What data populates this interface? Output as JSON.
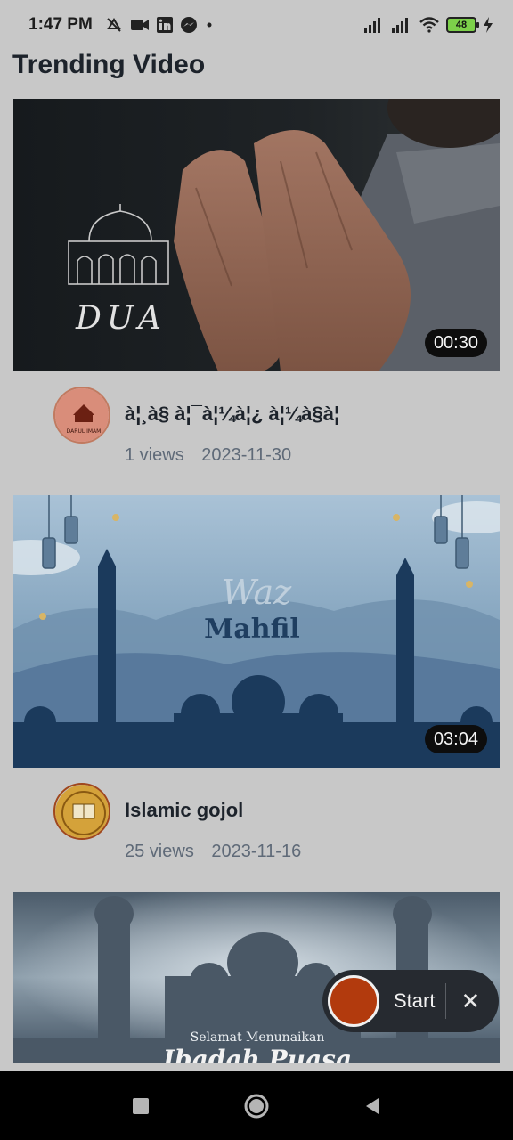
{
  "status_bar": {
    "time": "1:47 PM",
    "battery": "48",
    "icons": [
      "mute-icon",
      "video-camera-icon",
      "linkedin-icon",
      "messenger-icon",
      "dot-icon",
      "signal-icon",
      "signal-icon",
      "wifi-icon",
      "battery-icon",
      "charging-icon"
    ]
  },
  "page": {
    "title": "Trending Video"
  },
  "videos": [
    {
      "thumbnail_text": "DUA",
      "duration": "00:30",
      "title": "à¦¸à§ à¦¯à¦¼à¦¿ à¦¼à§à¦",
      "views": "1 views",
      "date": "2023-11-30",
      "channel_avatar_text": "DARUL IMAM"
    },
    {
      "thumbnail_text_top": "Waz",
      "thumbnail_text_bottom": "Mahfil",
      "duration": "03:04",
      "title": "Islamic gojol",
      "views": "25 views",
      "date": "2023-11-16"
    },
    {
      "thumbnail_text": "Selamat Menunaikan",
      "thumbnail_text_2": "Ibadah Puasa"
    }
  ],
  "recorder": {
    "start_label": "Start",
    "close_label": "✕"
  },
  "navbar": {
    "icons": [
      "recent-apps-icon",
      "home-icon",
      "back-icon"
    ]
  },
  "colors": {
    "background": "#c8c8c8",
    "record": "#b23a0d",
    "pill": "#262a30"
  }
}
